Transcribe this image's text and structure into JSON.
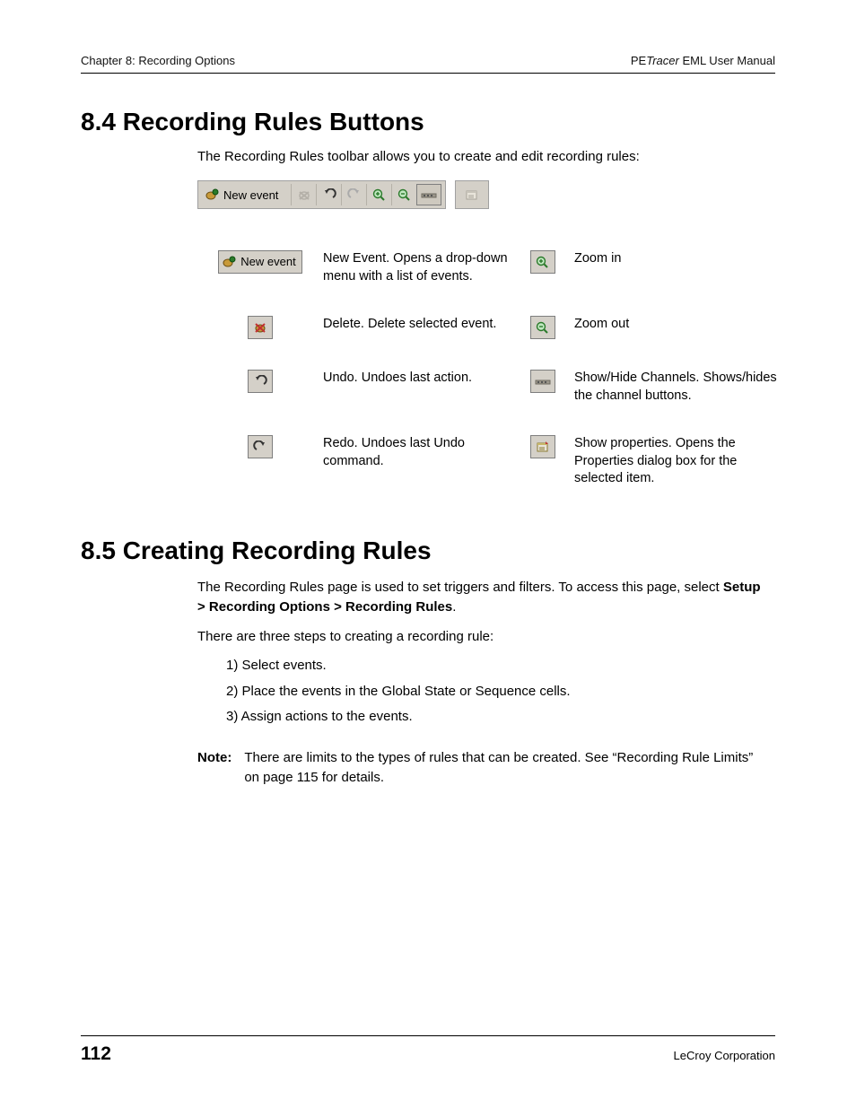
{
  "header": {
    "left": "Chapter 8: Recording Options",
    "right_prefix": "PE",
    "right_italic": "Tracer",
    "right_suffix": " EML User Manual"
  },
  "section84": {
    "title": "8.4 Recording Rules Buttons",
    "intro": "The Recording Rules toolbar allows you to create and edit recording rules:",
    "toolbar": {
      "new_event_label": "New event"
    },
    "rows": [
      {
        "left_label": "New event",
        "left_desc": "New Event. Opens a drop-down menu with a list of events.",
        "right_desc": "Zoom in"
      },
      {
        "left_desc": "Delete. Delete selected event.",
        "right_desc": "Zoom out"
      },
      {
        "left_desc": "Undo. Undoes last action.",
        "right_desc": "Show/Hide Channels. Shows/hides the channel buttons."
      },
      {
        "left_desc": "Redo. Undoes last Undo command.",
        "right_desc": "Show properties. Opens the Properties dialog box for the selected item."
      }
    ]
  },
  "section85": {
    "title": "8.5 Creating Recording Rules",
    "p1_a": "The Recording Rules page is used to set triggers and filters. To access this page, select ",
    "p1_b": "Setup > Recording Options > Recording Rules",
    "p1_c": ".",
    "p2": "There are three steps to creating a recording rule:",
    "steps": [
      "1) Select events.",
      "2) Place the events in the Global State or Sequence cells.",
      "3) Assign actions to the events."
    ],
    "note_label": "Note:",
    "note_text": "There are limits to the types of rules that can be created. See “Recording Rule Limits” on page 115 for details."
  },
  "footer": {
    "page": "112",
    "right": "LeCroy Corporation"
  }
}
